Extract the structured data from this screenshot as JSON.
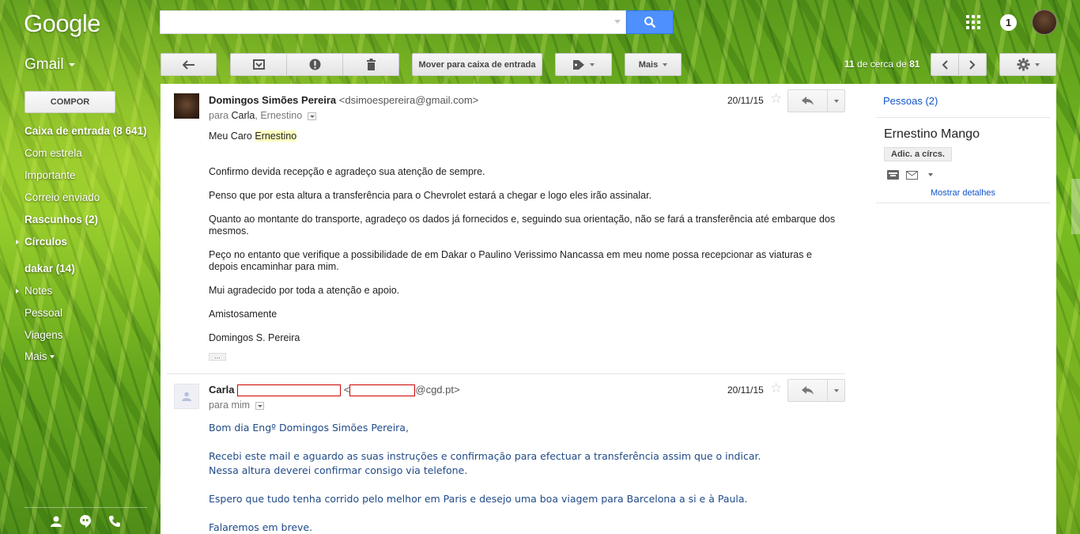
{
  "header": {
    "logo": "Google",
    "search": {
      "value": "",
      "placeholder": ""
    },
    "notifications": "1"
  },
  "app": {
    "name": "Gmail"
  },
  "toolbar": {
    "move_to_inbox": "Mover para caixa de entrada",
    "more": "Mais",
    "pager_current": "11",
    "pager_text": "de cerca de",
    "pager_total": "81"
  },
  "sidebar": {
    "compose": "COMPOR",
    "items": [
      {
        "label": "Caixa de entrada (8 641)"
      },
      {
        "label": "Com estrela"
      },
      {
        "label": "Importante"
      },
      {
        "label": "Correio enviado"
      },
      {
        "label": "Rascunhos (2)"
      },
      {
        "label": "Círculos"
      },
      {
        "label": "dakar (14)"
      },
      {
        "label": "Notes"
      },
      {
        "label": "Pessoal"
      },
      {
        "label": "Viagens"
      },
      {
        "label": "Mais"
      }
    ]
  },
  "messages": [
    {
      "sender": "Domingos Simões Pereira",
      "email": "<dsimoespereira@gmail.com>",
      "to_prefix": "para",
      "to_names": "Carla",
      "to_names2": "Ernestino",
      "date": "20/11/15",
      "greeting_pre": "Meu Caro ",
      "greeting_hl": "Ernestino",
      "paragraphs": [
        "Confirmo devida recepção e agradeço sua atenção de sempre.",
        "Penso que por esta altura a transferência para o Chevrolet estará a chegar e logo eles irão assinalar.",
        "Quanto ao montante do transporte, agradeço os dados já fornecidos e, seguindo sua orientação, não se fará a transferência até embarque dos mesmos.",
        "Peço no entanto que verifique a possibilidade de em Dakar o Paulino Verissimo Nancassa em meu nome possa recepcionar as viaturas e depois encaminhar para mim.",
        "Mui agradecido por toda a atenção e apoio.",
        "Amistosamente",
        "Domingos S. Pereira"
      ],
      "ellipsis": "..."
    },
    {
      "sender": "Carla",
      "email_open": "<",
      "email_domain": "@cgd.pt>",
      "to_line": "para mim",
      "date": "20/11/15",
      "paragraphs": [
        "Bom dia Engº Domingos Simões Pereira,",
        "Recebi este mail e aguardo as suas instruções e confirmação para efectuar a transferência assim que o indicar.",
        "Nessa altura deverei confirmar consigo via telefone.",
        "Espero que tudo tenha corrido pelo melhor em Paris e desejo uma boa viagem para Barcelona a si e à Paula.",
        "Falaremos em breve."
      ]
    }
  ],
  "people": {
    "link": "Pessoas (2)",
    "contact_name": "Ernestino Mango",
    "add_circles": "Adic. a círcs.",
    "show_details": "Mostrar detalhes"
  },
  "colors": {
    "search_button": "#4d90fe",
    "link": "#1155cc",
    "body2_text": "#1f4a87"
  }
}
